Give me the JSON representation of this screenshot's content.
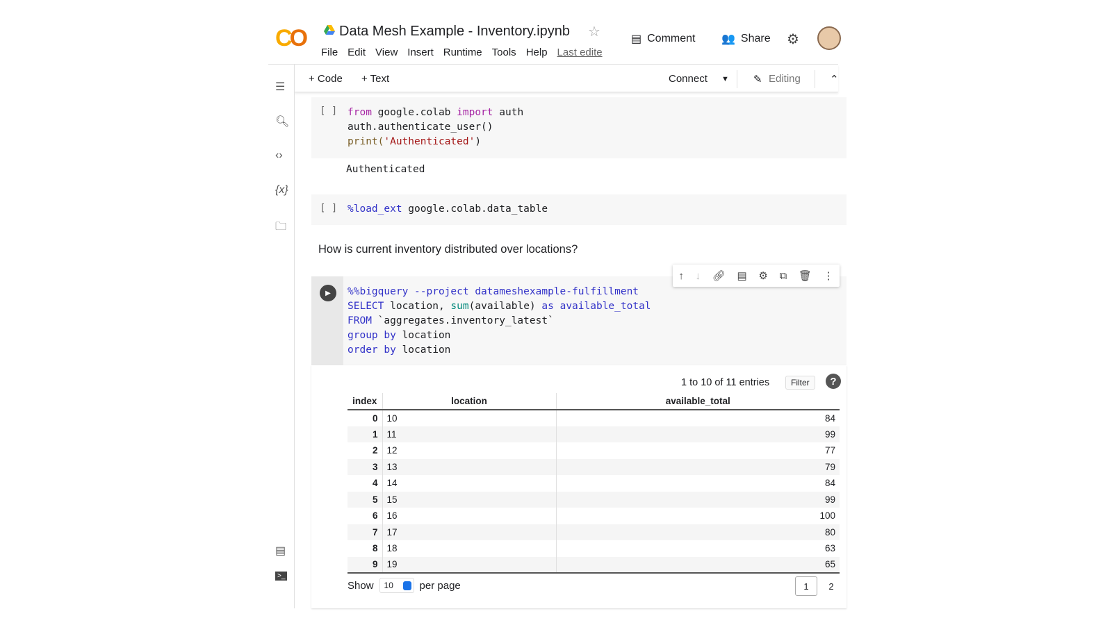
{
  "app": {
    "logo": "CO",
    "title": "Data Mesh Example - Inventory.ipynb"
  },
  "menu": [
    "File",
    "Edit",
    "View",
    "Insert",
    "Runtime",
    "Tools",
    "Help"
  ],
  "last_edited": "Last edite",
  "header": {
    "comment": "Comment",
    "share": "Share"
  },
  "toolbar": {
    "add_code": "+ Code",
    "add_text": "+ Text",
    "connect": "Connect",
    "editing": "Editing"
  },
  "cells": {
    "c1": {
      "bracket": "[ ]",
      "l1a": "from",
      "l1b": " google.colab ",
      "l1c": "import",
      "l1d": " auth",
      "l2": "auth.authenticate_user()",
      "l3a": "print(",
      "l3b": "'Authenticated'",
      "l3c": ")",
      "output": "Authenticated"
    },
    "c2": {
      "bracket": "[ ]",
      "a": "%load_ext",
      "b": " google.colab.data_table"
    },
    "md": "How is current inventory distributed over locations?",
    "c3": {
      "l1": "%%bigquery --project datameshexample-fulfillment",
      "l2a": "SELECT",
      "l2b": " location, ",
      "l2c": "sum",
      "l2d": "(available) ",
      "l2e": "as",
      "l2f": " available_total",
      "l3a": "FROM",
      "l3b": " `aggregates.inventory_latest`",
      "l4a": "group by",
      "l4b": " location",
      "l5a": "order by",
      "l5b": " location"
    }
  },
  "table": {
    "entries": "1 to 10 of 11 entries",
    "filter": "Filter",
    "help": "?",
    "columns": [
      "index",
      "location",
      "available_total"
    ],
    "rows": [
      [
        "0",
        "10",
        "84"
      ],
      [
        "1",
        "11",
        "99"
      ],
      [
        "2",
        "12",
        "77"
      ],
      [
        "3",
        "13",
        "79"
      ],
      [
        "4",
        "14",
        "84"
      ],
      [
        "5",
        "15",
        "99"
      ],
      [
        "6",
        "16",
        "100"
      ],
      [
        "7",
        "17",
        "80"
      ],
      [
        "8",
        "18",
        "63"
      ],
      [
        "9",
        "19",
        "65"
      ]
    ],
    "show": "Show",
    "per_page_value": "10",
    "per_page": "per page",
    "pages": [
      "1",
      "2"
    ]
  }
}
